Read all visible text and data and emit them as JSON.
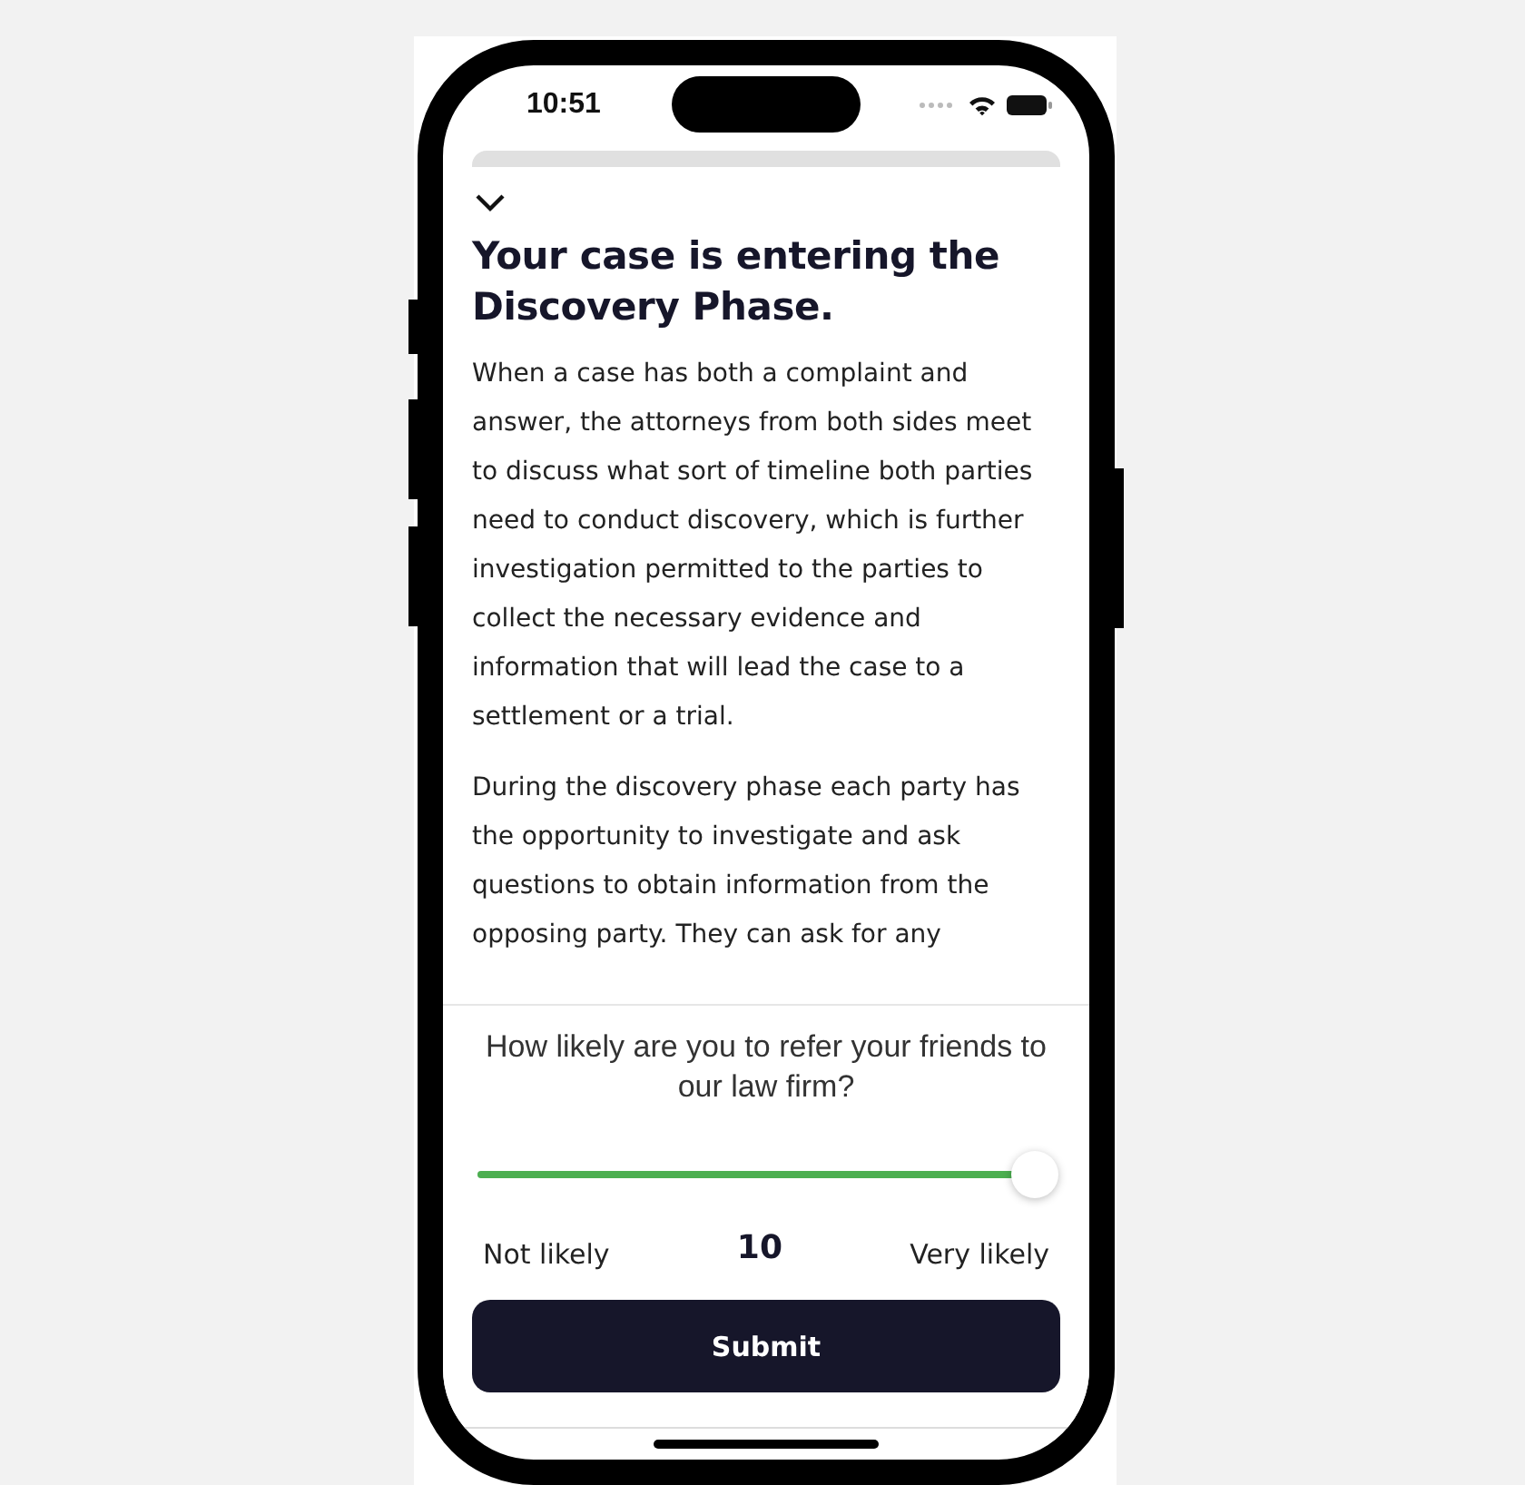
{
  "status_bar": {
    "time": "10:51"
  },
  "article": {
    "title": "Your case is entering the Discovery Phase.",
    "paragraphs": [
      "When a case has both a complaint and answer, the attorneys from both sides meet to discuss what sort of timeline both parties need to conduct discovery, which is further investigation permitted to the parties to collect the necessary evidence and information that will lead the case to a settlement or a trial.",
      "During the discovery phase each party has the opportunity to investigate and ask questions to obtain information from the opposing party. They can ask for any"
    ]
  },
  "survey": {
    "question": "How likely are you to refer your friends to our law firm?",
    "slider": {
      "level": 1.0
    },
    "min_label": "Not likely",
    "value": "10",
    "max_label": "Very likely",
    "submit": "Submit"
  }
}
